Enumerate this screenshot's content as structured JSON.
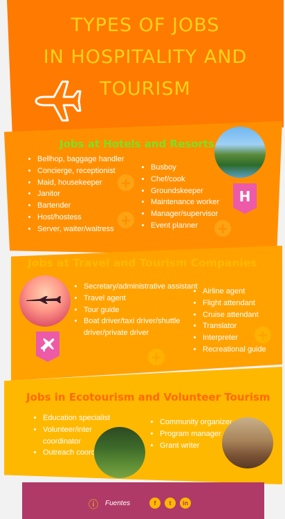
{
  "header": {
    "title_lines": [
      "TYPES OF JOBS",
      "IN HOSPITALITY AND",
      "TOURISM"
    ],
    "icon": "airplane-icon"
  },
  "sections": [
    {
      "title": "Jobs at Hotels and Resorts",
      "col1": [
        "Bellhop, baggage handler",
        "Concierge, receptionist",
        "Maid, housekeeper",
        "Janitor",
        "Bartender",
        "Host/hostess",
        "Server, waiter/waitress"
      ],
      "col2": [
        "Busboy",
        "Chef/cook",
        "Groundskeeper",
        "Maintenance worker",
        "Manager/supervisor",
        "Event planner"
      ],
      "badge": "H"
    },
    {
      "title": "Jobs at Travel and Tourism Companies",
      "col1": [
        "Secretary/administrative assistant",
        "Travel agent",
        "Tour guide",
        "Boat driver/taxi driver/shuttle driver/private driver"
      ],
      "col2": [
        "Airline agent",
        "Flight attendant",
        "Cruise attendant",
        "Translator",
        "Interpreter",
        "Recreational guide"
      ]
    },
    {
      "title": "Jobs in Ecotourism and Volunteer Tourism",
      "col1": [
        "Education specialist",
        "Volunteer/inter coordinator",
        "Outreach coordinator"
      ],
      "col2": [
        "Community organizer",
        "Program manager",
        "Grant writer"
      ]
    }
  ],
  "footer": {
    "info_icon": "info-icon",
    "label": "Fuentes",
    "social": [
      "f",
      "t",
      "in"
    ]
  },
  "colors": {
    "band1": "#ff7a00",
    "band2": "#ff8f00",
    "band3": "#ffa200",
    "band4": "#ffb800",
    "footer": "#b03a67",
    "title": "#ffd21a",
    "badge": "#ec5aa8"
  }
}
